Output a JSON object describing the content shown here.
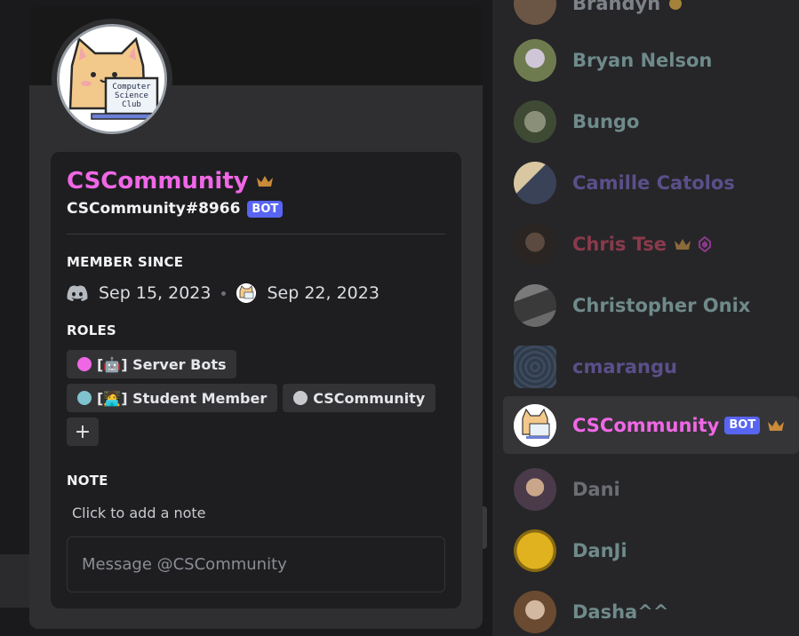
{
  "profile": {
    "display_name": "CSCommunity",
    "username": "CSCommunity#8966",
    "bot_label": "BOT",
    "avatar_text": [
      "Computer",
      "Science",
      "Club"
    ],
    "member_since_title": "MEMBER SINCE",
    "discord_joined": "Sep 15, 2023",
    "server_joined": "Sep 22, 2023",
    "roles_title": "ROLES",
    "roles": [
      {
        "label": "[🤖] Server Bots",
        "color": "#f067e6"
      },
      {
        "label": "[🧑‍💻] Student Member",
        "color": "#7fc3cf"
      },
      {
        "label": "CSCommunity",
        "color": "#c7c9cc"
      }
    ],
    "add_role_label": "+",
    "note_title": "NOTE",
    "note_placeholder": "Click to add a note",
    "message_placeholder": "Message @CSCommunity"
  },
  "members": [
    {
      "name": "Brandyn",
      "color": "#7e8289"
    },
    {
      "name": "Bryan Nelson",
      "color": "#6f8a8a"
    },
    {
      "name": "Bungo",
      "color": "#6f8a8a"
    },
    {
      "name": "Camille Catolos",
      "color": "#5b4f8a"
    },
    {
      "name": "Chris Tse",
      "color": "#8a3a4c"
    },
    {
      "name": "Christopher Onix",
      "color": "#6f8a8a"
    },
    {
      "name": "cmarangu",
      "color": "#5b4f8a"
    },
    {
      "name": "CSCommunity",
      "color": "#f067e6",
      "badge": "BOT"
    },
    {
      "name": "Dani",
      "color": "#6b6e73"
    },
    {
      "name": "DanJi",
      "color": "#6f8a8a"
    },
    {
      "name": "Dasha^^",
      "color": "#6f8a8a"
    }
  ],
  "colors": {
    "accent": "#5865f2",
    "crown": "#c98a3a"
  }
}
